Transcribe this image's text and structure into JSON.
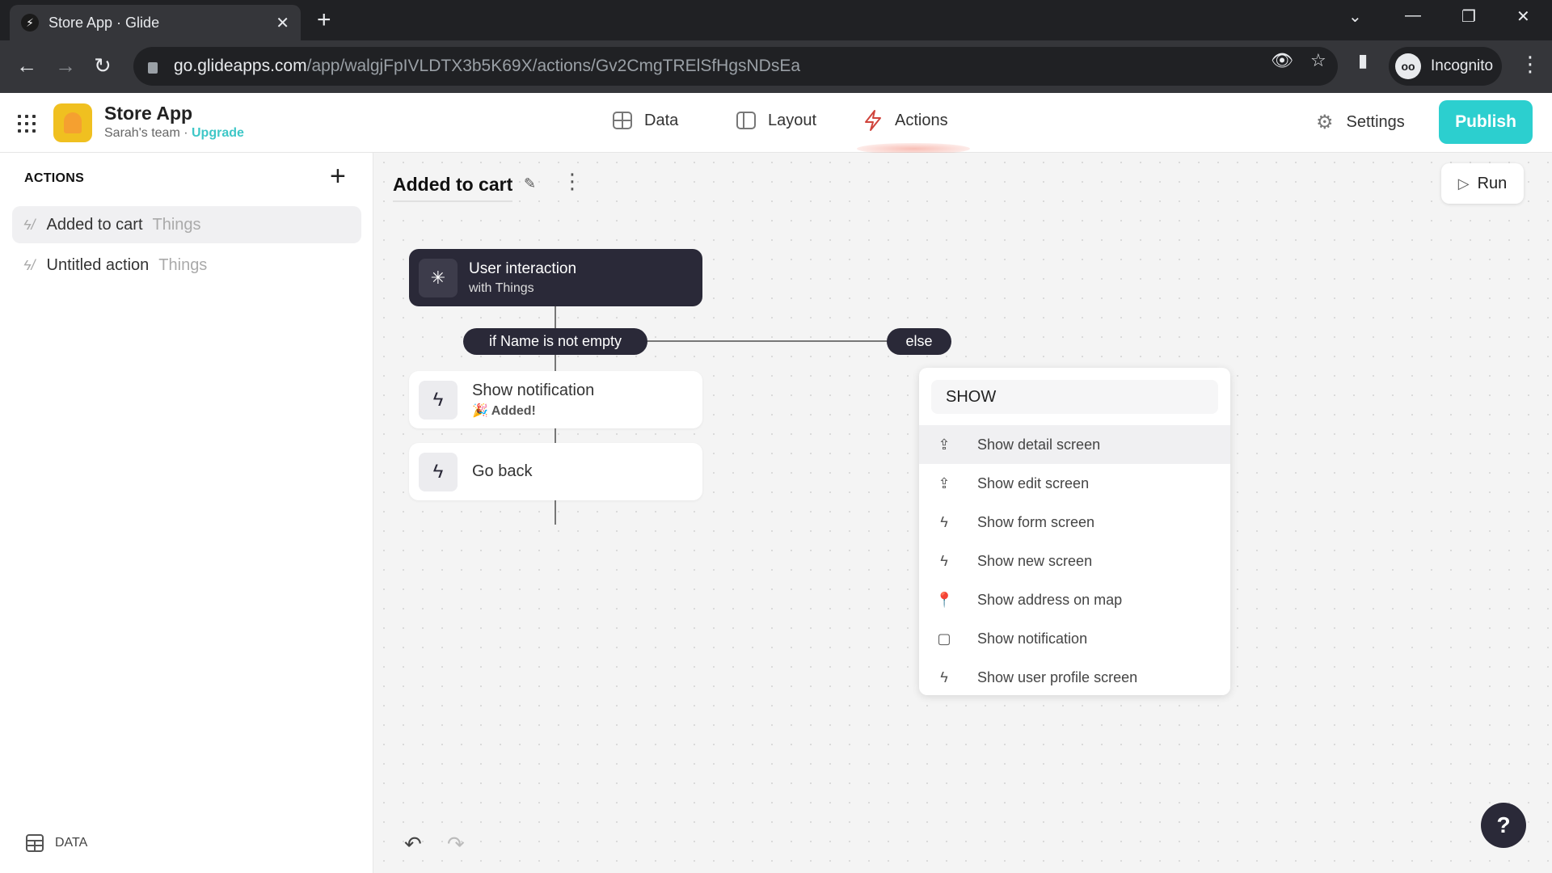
{
  "browser": {
    "tab_title": "Store App · Glide",
    "url_host": "go.glideapps.com",
    "url_path": "/app/walgjFpIVLDTX3b5K69X/actions/Gv2CmgTRElSfHgsNDsEa",
    "profile_label": "Incognito"
  },
  "header": {
    "app_name": "Store App",
    "team": "Sarah's team",
    "separator": " · ",
    "upgrade": "Upgrade",
    "nav": [
      {
        "label": "Data",
        "icon": "table-icon",
        "active": false
      },
      {
        "label": "Layout",
        "icon": "layout-icon",
        "active": false
      },
      {
        "label": "Actions",
        "icon": "bolt-icon",
        "active": true
      }
    ],
    "settings_label": "Settings",
    "publish_label": "Publish",
    "accent_color": "#2ccfcf",
    "active_color": "#d0443c"
  },
  "sidebar": {
    "title": "ACTIONS",
    "items": [
      {
        "label": "Added to cart",
        "table": "Things",
        "active": true
      },
      {
        "label": "Untitled action",
        "table": "Things",
        "active": false
      }
    ],
    "footer_label": "DATA"
  },
  "canvas": {
    "action_title": "Added to cart",
    "run_label": "Run",
    "trigger": {
      "title": "User interaction",
      "subtitle": "with Things"
    },
    "condition_label": "if Name is not empty",
    "else_label": "else",
    "nodes": [
      {
        "title": "Show notification",
        "subtitle": "Added!",
        "emoji": "🎉"
      },
      {
        "title": "Go back"
      }
    ]
  },
  "picker": {
    "search_value": "SHOW",
    "items": [
      {
        "label": "Show detail screen",
        "icon": "share-up-icon"
      },
      {
        "label": "Show edit screen",
        "icon": "share-up-icon"
      },
      {
        "label": "Show form screen",
        "icon": "bolt-icon"
      },
      {
        "label": "Show new screen",
        "icon": "bolt-icon"
      },
      {
        "label": "Show address on map",
        "icon": "map-pin-icon"
      },
      {
        "label": "Show notification",
        "icon": "clipboard-icon"
      },
      {
        "label": "Show user profile screen",
        "icon": "bolt-icon"
      }
    ]
  },
  "help_label": "?"
}
